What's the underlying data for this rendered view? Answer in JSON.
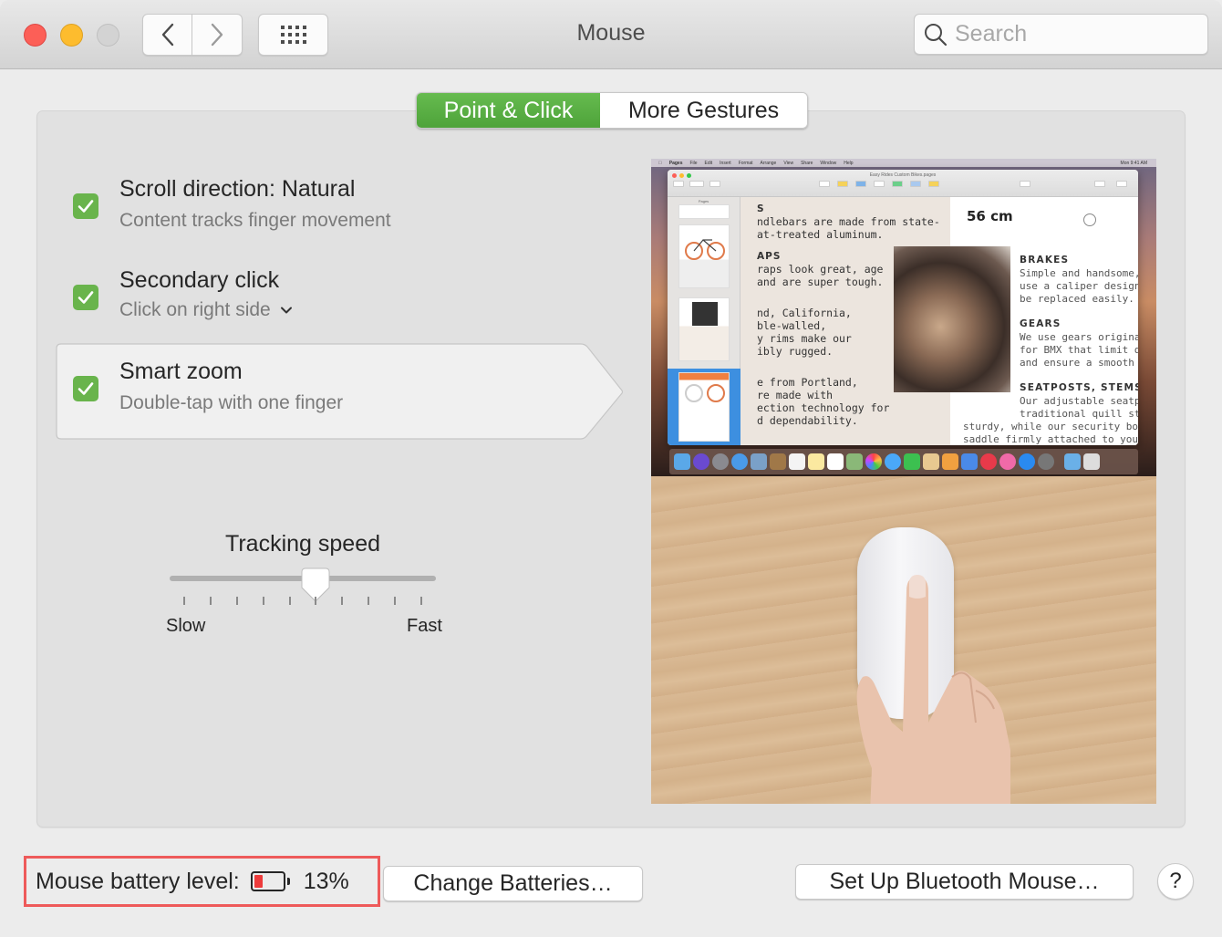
{
  "window": {
    "title": "Mouse",
    "search_placeholder": "Search",
    "search_value": ""
  },
  "tabs": [
    {
      "label": "Point & Click",
      "active": true
    },
    {
      "label": "More Gestures",
      "active": false
    }
  ],
  "options": [
    {
      "title": "Scroll direction: Natural",
      "subtitle": "Content tracks finger movement",
      "checked": true,
      "selected": false
    },
    {
      "title": "Secondary click",
      "subtitle": "Click on right side",
      "has_dropdown": true,
      "checked": true,
      "selected": false
    },
    {
      "title": "Smart zoom",
      "subtitle": "Double-tap with one finger",
      "checked": true,
      "selected": true
    }
  ],
  "tracking": {
    "label": "Tracking speed",
    "min_label": "Slow",
    "max_label": "Fast",
    "tick_count": 10,
    "value_tick_index": 5
  },
  "preview": {
    "menubar_items": [
      "Pages",
      "File",
      "Edit",
      "Insert",
      "Format",
      "Arrange",
      "View",
      "Share",
      "Window",
      "Help"
    ],
    "menubar_clock": "Mon 9:41 AM",
    "doc_title": "Easy Rides Custom Bikes.pages",
    "sidebar_label": "Pages",
    "left_text": [
      {
        "type": "h",
        "text": "S"
      },
      {
        "type": "p",
        "text": "ndlebars are made from state-"
      },
      {
        "type": "p",
        "text": "at-treated aluminum."
      },
      {
        "type": "gap",
        "text": ""
      },
      {
        "type": "h",
        "text": "APS"
      },
      {
        "type": "p",
        "text": "raps look great, age"
      },
      {
        "type": "p",
        "text": "and are super tough."
      },
      {
        "type": "gap",
        "text": ""
      },
      {
        "type": "gap",
        "text": ""
      },
      {
        "type": "p",
        "text": "nd, California,"
      },
      {
        "type": "p",
        "text": "ble-walled,"
      },
      {
        "type": "p",
        "text": "y rims make our"
      },
      {
        "type": "p",
        "text": "ibly rugged."
      },
      {
        "type": "gap",
        "text": ""
      },
      {
        "type": "gap",
        "text": ""
      },
      {
        "type": "p",
        "text": "e from Portland,"
      },
      {
        "type": "p",
        "text": "re made with"
      },
      {
        "type": "p",
        "text": "ection technology for"
      },
      {
        "type": "p",
        "text": "d dependability."
      }
    ],
    "size_label": "56 cm",
    "brakes_heading": "BRAKES",
    "brakes_lines": [
      "Simple and handsome, o",
      "use a caliper design s",
      "be replaced easily."
    ],
    "gears_heading": "GEARS",
    "gears_lines": [
      "We use gears originall",
      "for BMX that limit di",
      "and ensure a smooth ri"
    ],
    "seatposts_heading": "SEATPOSTS, STEMS &",
    "seatposts_lines": [
      "Our adjustable seatpos",
      "traditional quill stem"
    ],
    "seatposts_wide_lines": [
      "sturdy, while our security bol",
      "saddle firmly attached to your"
    ]
  },
  "footer": {
    "battery_label": "Mouse battery level:",
    "battery_percent_text": "13%",
    "battery_level": 0.13,
    "change_batteries_label": "Change Batteries…",
    "setup_bluetooth_label": "Set Up Bluetooth Mouse…",
    "help_label": "?"
  },
  "colors": {
    "accent_green": "#5cb146",
    "checkbox_green": "#69b44c",
    "battery_low_red": "#ee3b3b",
    "highlight_box_red": "#ee5a5a"
  }
}
